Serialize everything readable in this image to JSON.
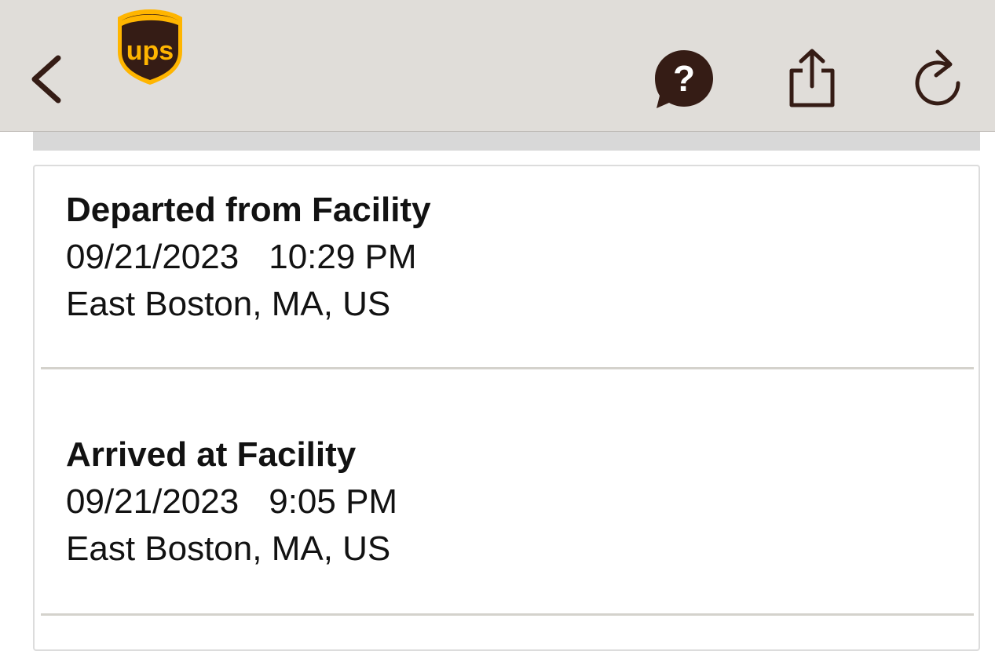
{
  "header": {
    "logo_text": "ups",
    "back_icon": "chevron-left-icon",
    "help_icon": "question-bubble-icon",
    "share_icon": "share-icon",
    "refresh_icon": "refresh-icon",
    "bar_color": "#e0ddd9",
    "icon_color": "#351c15",
    "logo_brown": "#351c15",
    "logo_gold": "#ffb500"
  },
  "events": [
    {
      "title": "Departed from Facility",
      "date": "09/21/2023",
      "time": "10:29 PM",
      "location": "East Boston, MA, US"
    },
    {
      "title": "Arrived at Facility",
      "date": "09/21/2023",
      "time": "9:05 PM",
      "location": "East Boston, MA, US"
    }
  ]
}
